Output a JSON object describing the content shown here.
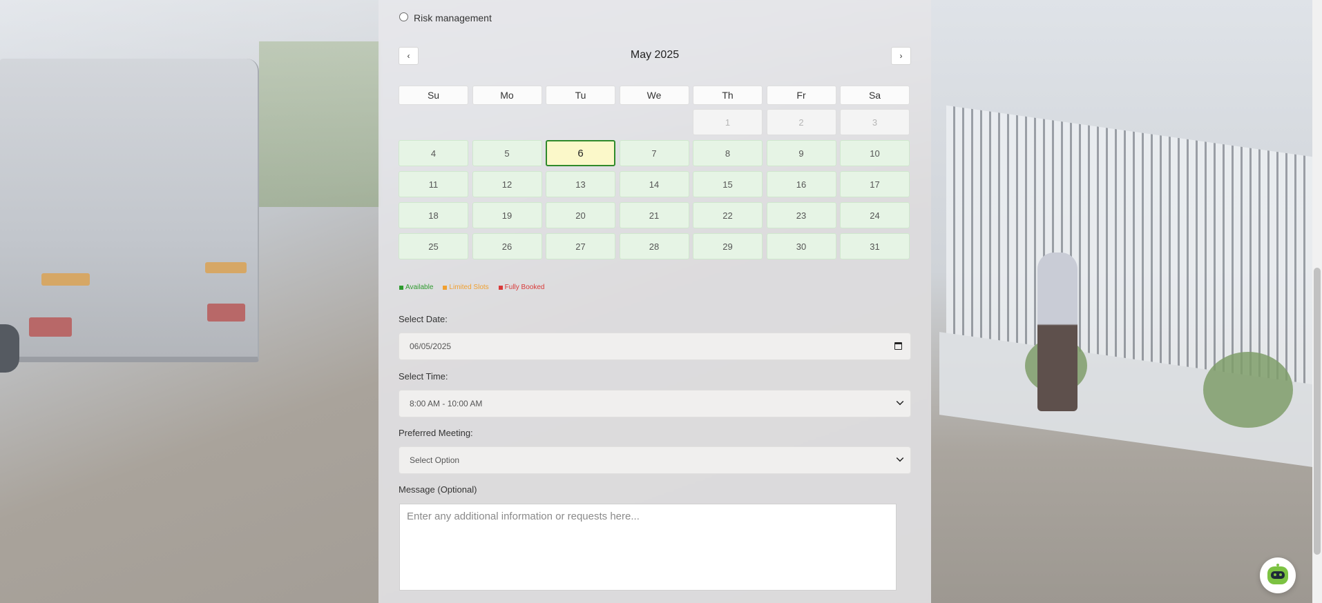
{
  "service_options": {
    "risk_label": "Risk management"
  },
  "calendar": {
    "title": "May 2025",
    "prev_label": "‹",
    "next_label": "›",
    "weekdays": [
      "Su",
      "Mo",
      "Tu",
      "We",
      "Th",
      "Fr",
      "Sa"
    ],
    "weeks": [
      [
        {
          "d": ""
        },
        {
          "d": ""
        },
        {
          "d": ""
        },
        {
          "d": ""
        },
        {
          "d": "1",
          "s": "past"
        },
        {
          "d": "2",
          "s": "past"
        },
        {
          "d": "3",
          "s": "past"
        }
      ],
      [
        {
          "d": "4",
          "s": "available"
        },
        {
          "d": "5",
          "s": "available"
        },
        {
          "d": "6",
          "s": "selected"
        },
        {
          "d": "7",
          "s": "available"
        },
        {
          "d": "8",
          "s": "available"
        },
        {
          "d": "9",
          "s": "available"
        },
        {
          "d": "10",
          "s": "available"
        }
      ],
      [
        {
          "d": "11",
          "s": "available"
        },
        {
          "d": "12",
          "s": "available"
        },
        {
          "d": "13",
          "s": "available"
        },
        {
          "d": "14",
          "s": "available"
        },
        {
          "d": "15",
          "s": "available"
        },
        {
          "d": "16",
          "s": "available"
        },
        {
          "d": "17",
          "s": "available"
        }
      ],
      [
        {
          "d": "18",
          "s": "available"
        },
        {
          "d": "19",
          "s": "available"
        },
        {
          "d": "20",
          "s": "available"
        },
        {
          "d": "21",
          "s": "available"
        },
        {
          "d": "22",
          "s": "available"
        },
        {
          "d": "23",
          "s": "available"
        },
        {
          "d": "24",
          "s": "available"
        }
      ],
      [
        {
          "d": "25",
          "s": "available"
        },
        {
          "d": "26",
          "s": "available"
        },
        {
          "d": "27",
          "s": "available"
        },
        {
          "d": "28",
          "s": "available"
        },
        {
          "d": "29",
          "s": "available"
        },
        {
          "d": "30",
          "s": "available"
        },
        {
          "d": "31",
          "s": "available"
        }
      ]
    ]
  },
  "legend": {
    "available": {
      "label": "Available",
      "color": "#2e9a2e"
    },
    "limited": {
      "label": "Limited Slots",
      "color": "#f0a030"
    },
    "booked": {
      "label": "Fully Booked",
      "color": "#d93a3a"
    }
  },
  "form": {
    "date_label": "Select Date:",
    "date_value": "06/05/2025",
    "time_label": "Select Time:",
    "time_value": "8:00 AM - 10:00 AM",
    "meeting_label": "Preferred Meeting:",
    "meeting_value": "Select Option",
    "message_label": "Message (Optional)",
    "message_placeholder": "Enter any additional information or requests here..."
  },
  "chat": {
    "icon": "chatbot-icon"
  }
}
